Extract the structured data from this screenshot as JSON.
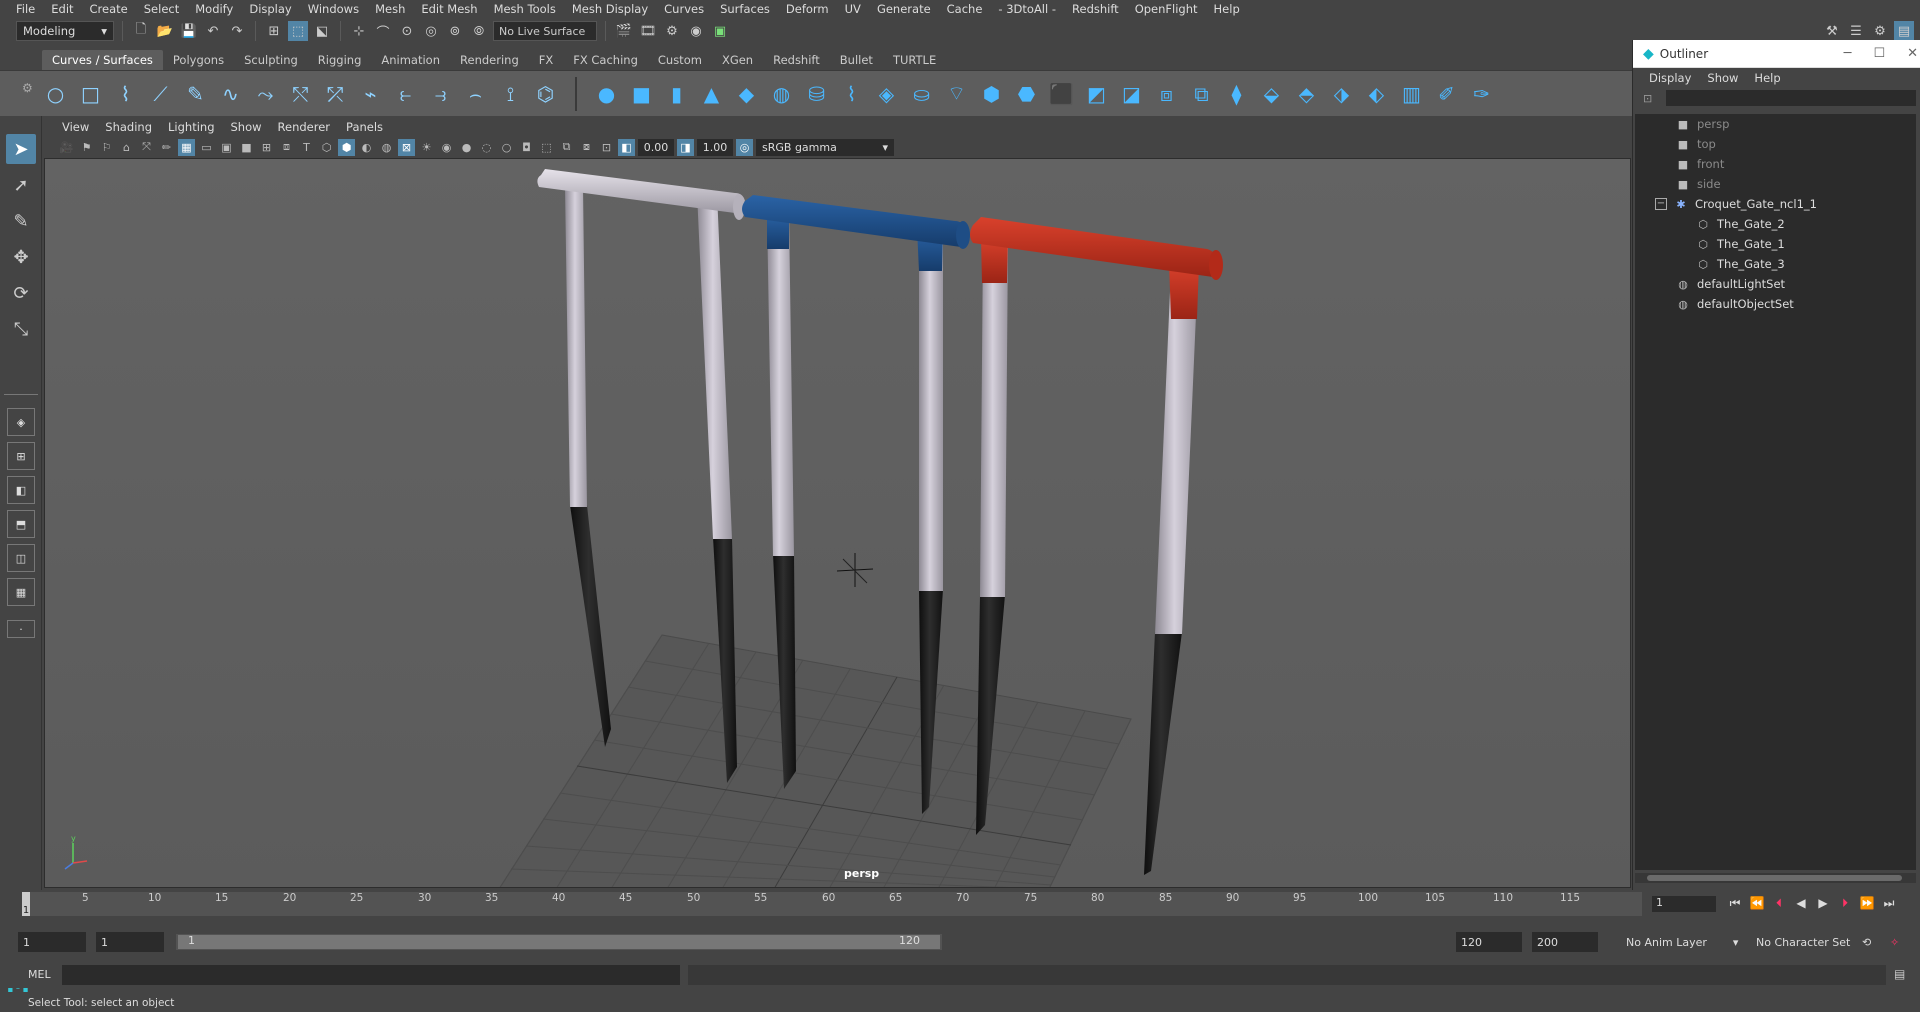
{
  "menus": [
    "File",
    "Edit",
    "Create",
    "Select",
    "Modify",
    "Display",
    "Windows",
    "Mesh",
    "Edit Mesh",
    "Mesh Tools",
    "Mesh Display",
    "Curves",
    "Surfaces",
    "Deform",
    "UV",
    "Generate",
    "Cache",
    "- 3DtoAll -",
    "Redshift",
    "OpenFlight",
    "Help"
  ],
  "status": {
    "workspace": "Modeling",
    "live_surface": "No Live Surface"
  },
  "shelf_tabs": [
    "Curves / Surfaces",
    "Polygons",
    "Sculpting",
    "Rigging",
    "Animation",
    "Rendering",
    "FX",
    "FX Caching",
    "Custom",
    "XGen",
    "Redshift",
    "Bullet",
    "TURTLE"
  ],
  "panel_menus": [
    "View",
    "Shading",
    "Lighting",
    "Show",
    "Renderer",
    "Panels"
  ],
  "panel_toolbar": {
    "exposure": "0.00",
    "gamma": "1.00",
    "color_space": "sRGB gamma"
  },
  "viewport": {
    "camera": "persp"
  },
  "outliner": {
    "title": "Outliner",
    "menus": [
      "Display",
      "Show",
      "Help"
    ],
    "items": [
      {
        "label": "persp"
      },
      {
        "label": "top"
      },
      {
        "label": "front"
      },
      {
        "label": "side"
      },
      {
        "label": "Croquet_Gate_ncl1_1"
      },
      {
        "label": "The_Gate_2"
      },
      {
        "label": "The_Gate_1"
      },
      {
        "label": "The_Gate_3"
      },
      {
        "label": "defaultLightSet"
      },
      {
        "label": "defaultObjectSet"
      }
    ]
  },
  "timeline": {
    "ticks": [
      "5",
      "10",
      "15",
      "20",
      "25",
      "30",
      "35",
      "40",
      "45",
      "50",
      "55",
      "60",
      "65",
      "70",
      "75",
      "80",
      "85",
      "90",
      "95",
      "100",
      "105",
      "110",
      "115"
    ],
    "current": "1",
    "current_frame": "1"
  },
  "range": {
    "start": "1",
    "playback_start": "1",
    "bar_start": "1",
    "bar_end": "120",
    "playback_end": "120",
    "end": "200",
    "anim_layer": "No Anim Layer",
    "character_set": "No Character Set"
  },
  "command": {
    "label": "MEL"
  },
  "help_line": "Select Tool: select an object",
  "colors": {
    "gate_white": "#c9c4cf",
    "gate_blue": "#1d4f8a",
    "gate_red": "#c1301f",
    "gate_black": "#1b1b1b",
    "accent": "#5285a6"
  }
}
